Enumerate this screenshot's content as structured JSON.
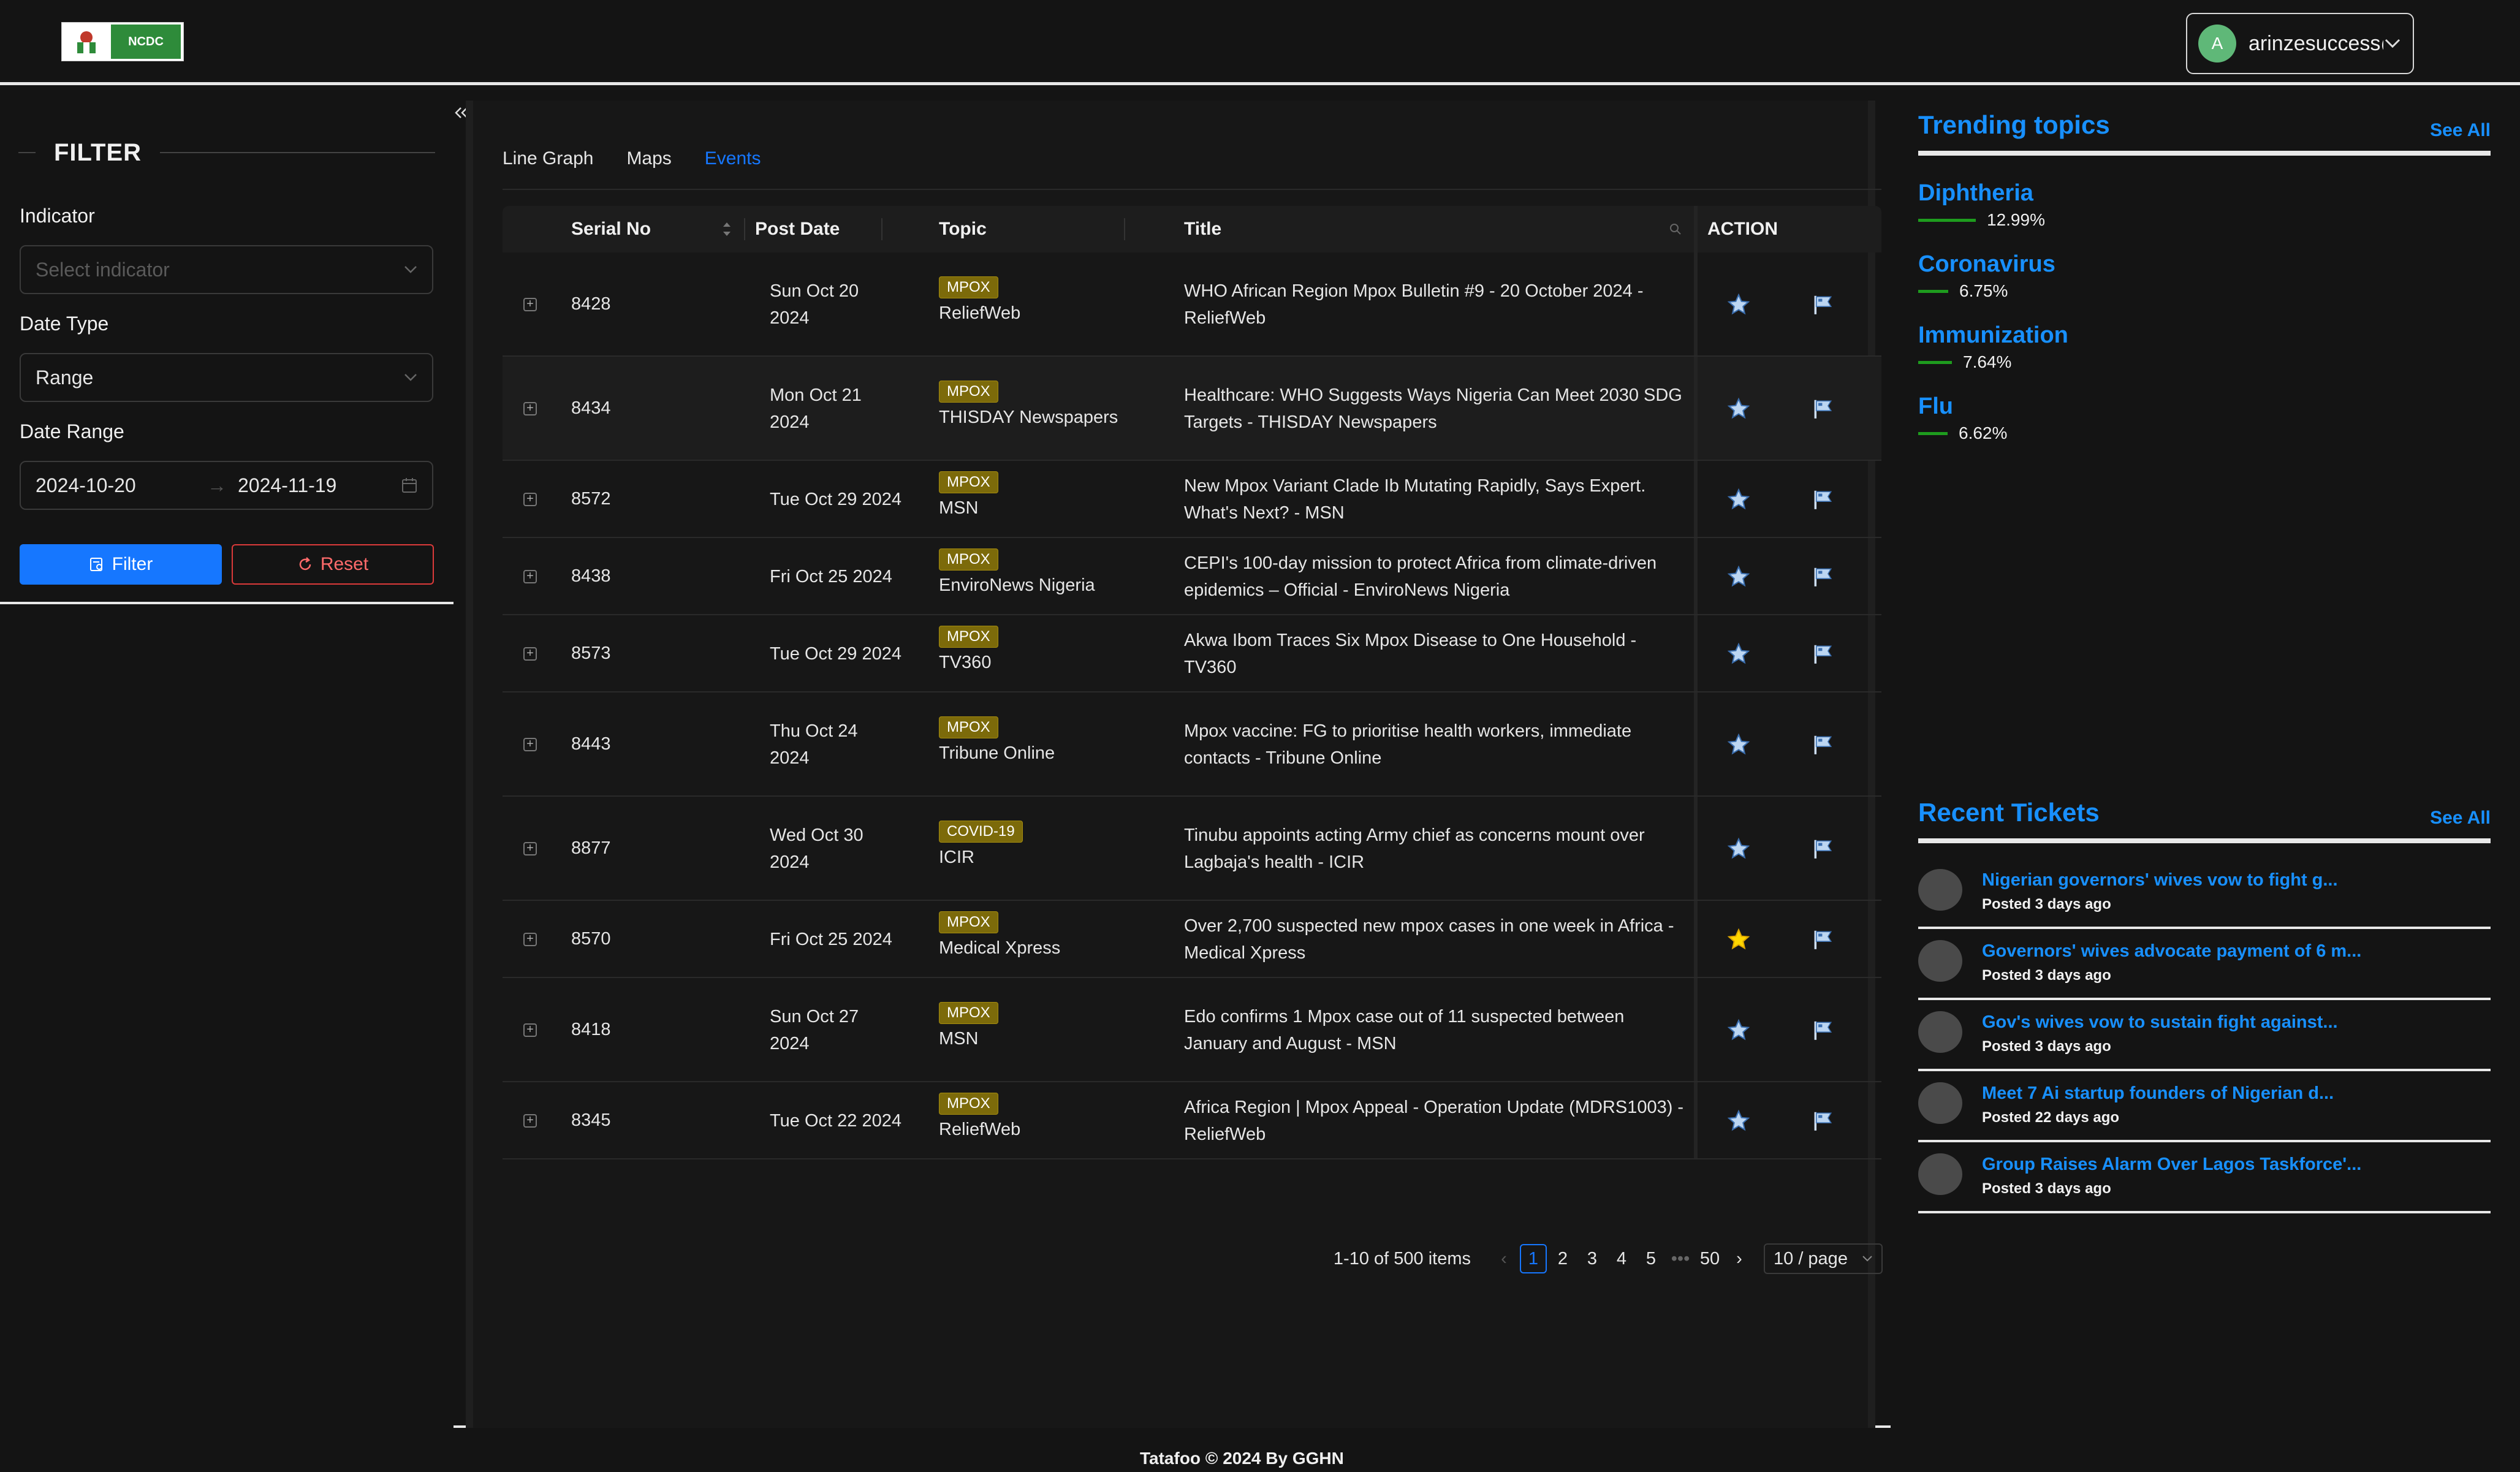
{
  "header": {
    "logo_text": "NCDC",
    "avatar_letter": "A",
    "user_email": "arinzesuccess@g..."
  },
  "filter": {
    "title": "FILTER",
    "indicator_label": "Indicator",
    "indicator_placeholder": "Select indicator",
    "date_type_label": "Date Type",
    "date_type_value": "Range",
    "date_range_label": "Date Range",
    "date_from": "2024-10-20",
    "date_to": "2024-11-19",
    "filter_button": "Filter",
    "reset_button": "Reset"
  },
  "tabs": [
    {
      "label": "Line Graph"
    },
    {
      "label": "Maps"
    },
    {
      "label": "Events"
    }
  ],
  "active_tab": "Events",
  "table": {
    "columns": [
      "Serial No",
      "Post Date",
      "Topic",
      "Title",
      "ACTION"
    ],
    "rows": [
      {
        "serial": "8428",
        "date": "Sun Oct 20\n2024",
        "tag": "MPOX",
        "source": "ReliefWeb",
        "title": "WHO African Region Mpox Bulletin #9 - 20 October 2024 -\nReliefWeb",
        "starred": false
      },
      {
        "serial": "8434",
        "date": "Mon Oct 21\n2024",
        "tag": "MPOX",
        "source": "THISDAY Newspapers",
        "title": "Healthcare: WHO Suggests Ways Nigeria Can Meet 2030 SDG\nTargets - THISDAY Newspapers",
        "starred": false
      },
      {
        "serial": "8572",
        "date": "Tue Oct 29 2024",
        "tag": "MPOX",
        "source": "MSN",
        "title": "New Mpox Variant Clade Ib Mutating Rapidly, Says Expert.\nWhat's Next? - MSN",
        "starred": false
      },
      {
        "serial": "8438",
        "date": "Fri Oct 25 2024",
        "tag": "MPOX",
        "source": "EnviroNews Nigeria",
        "title": "CEPI's 100-day mission to protect Africa from climate-driven\nepidemics – Official - EnviroNews Nigeria",
        "starred": false
      },
      {
        "serial": "8573",
        "date": "Tue Oct 29 2024",
        "tag": "MPOX",
        "source": "TV360",
        "title": "Akwa Ibom Traces Six Mpox Disease to One Household -\nTV360",
        "starred": false
      },
      {
        "serial": "8443",
        "date": "Thu Oct 24\n2024",
        "tag": "MPOX",
        "source": "Tribune Online",
        "title": "Mpox vaccine: FG to prioritise health workers, immediate\ncontacts - Tribune Online",
        "starred": false
      },
      {
        "serial": "8877",
        "date": "Wed Oct 30\n2024",
        "tag": "COVID-19",
        "source": "ICIR",
        "title": "Tinubu appoints acting Army chief as concerns mount over\nLagbaja's health - ICIR",
        "starred": false
      },
      {
        "serial": "8570",
        "date": "Fri Oct 25 2024",
        "tag": "MPOX",
        "source": "Medical Xpress",
        "title": "Over 2,700 suspected new mpox cases in one week in Africa -\nMedical Xpress",
        "starred": true
      },
      {
        "serial": "8418",
        "date": "Sun Oct 27\n2024",
        "tag": "MPOX",
        "source": "MSN",
        "title": "Edo confirms 1 Mpox case out of 11 suspected between\nJanuary and August - MSN",
        "starred": false
      },
      {
        "serial": "8345",
        "date": "Tue Oct 22 2024",
        "tag": "MPOX",
        "source": "ReliefWeb",
        "title": "Africa Region | Mpox Appeal - Operation Update (MDRS1003) -\nReliefWeb",
        "starred": false
      }
    ]
  },
  "pagination": {
    "summary": "1-10 of 500 items",
    "pages": [
      "1",
      "2",
      "3",
      "4",
      "5",
      "•••",
      "50"
    ],
    "current": "1",
    "page_size": "10 / page"
  },
  "trending": {
    "title": "Trending topics",
    "see_all": "See All",
    "items": [
      {
        "name": "Diphtheria",
        "pct": "12.99%",
        "share": 12.99
      },
      {
        "name": "Coronavirus",
        "pct": "6.75%",
        "share": 6.75
      },
      {
        "name": "Immunization",
        "pct": "7.64%",
        "share": 7.64
      },
      {
        "name": "Flu",
        "pct": "6.62%",
        "share": 6.62
      }
    ]
  },
  "tickets": {
    "title": "Recent Tickets",
    "see_all": "See All",
    "items": [
      {
        "title": "Nigerian governors' wives vow to fight g...",
        "ago": "Posted 3 days ago"
      },
      {
        "title": "Governors' wives advocate payment of 6 m...",
        "ago": "Posted 3 days ago"
      },
      {
        "title": "Gov's wives vow to sustain fight against...",
        "ago": "Posted 3 days ago"
      },
      {
        "title": "Meet 7 Ai startup founders of Nigerian d...",
        "ago": "Posted 22 days ago"
      },
      {
        "title": "Group Raises Alarm Over Lagos Taskforce'...",
        "ago": "Posted 3 days ago"
      }
    ]
  },
  "footer": {
    "text": "Tatafoo © 2024  By GGHN"
  },
  "colors": {
    "accent": "#1677ff",
    "link": "#1890ff",
    "tag_bg": "#7c6a0a",
    "reset": "#dc3a3a",
    "trend_bar": "#1e9c1e"
  }
}
